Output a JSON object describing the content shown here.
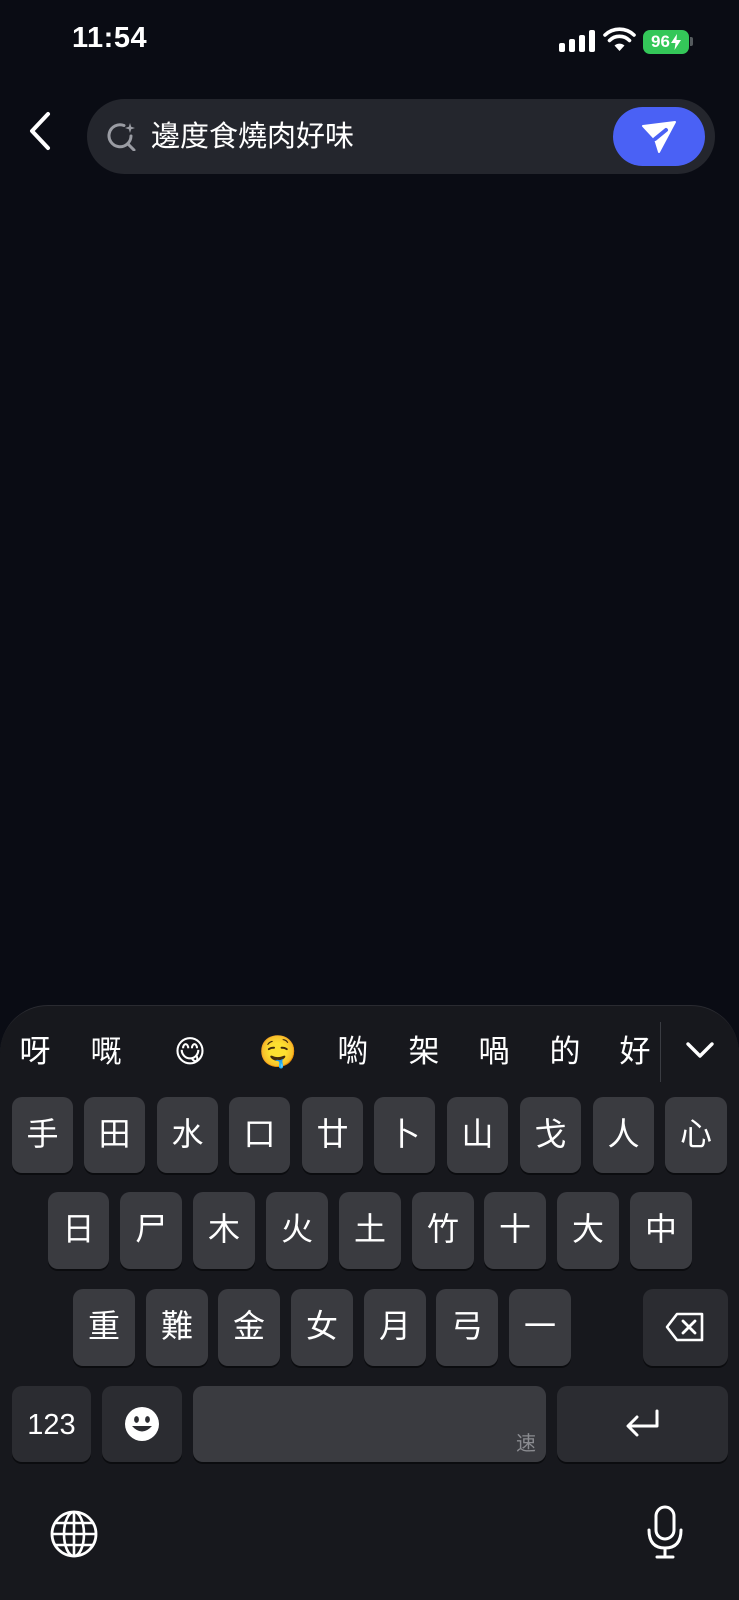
{
  "status_bar": {
    "time": "11:54",
    "battery": "96",
    "battery_color": "#34c759"
  },
  "header": {
    "back_icon": "chevron-left-icon",
    "search_icon": "search-sparkle-icon",
    "search_text": "邊度食燒肉好味",
    "send_icon": "send-icon",
    "send_color": "#4a61f5"
  },
  "keyboard": {
    "candidates": [
      "呀",
      "嘅",
      "😋",
      "🤤",
      "喲",
      "架",
      "喎",
      "的",
      "好"
    ],
    "collapse_icon": "chevron-down-icon",
    "row1": [
      "手",
      "田",
      "水",
      "口",
      "廿",
      "卜",
      "山",
      "戈",
      "人",
      "心"
    ],
    "row2": [
      "日",
      "尸",
      "木",
      "火",
      "土",
      "竹",
      "十",
      "大",
      "中"
    ],
    "row3": [
      "重",
      "難",
      "金",
      "女",
      "月",
      "弓",
      "一"
    ],
    "delete_icon": "backspace-icon",
    "numbers_label": "123",
    "emoji_icon": "emoji-icon",
    "space_hint": "速",
    "return_icon": "return-icon",
    "globe_icon": "globe-icon",
    "mic_icon": "microphone-icon"
  }
}
